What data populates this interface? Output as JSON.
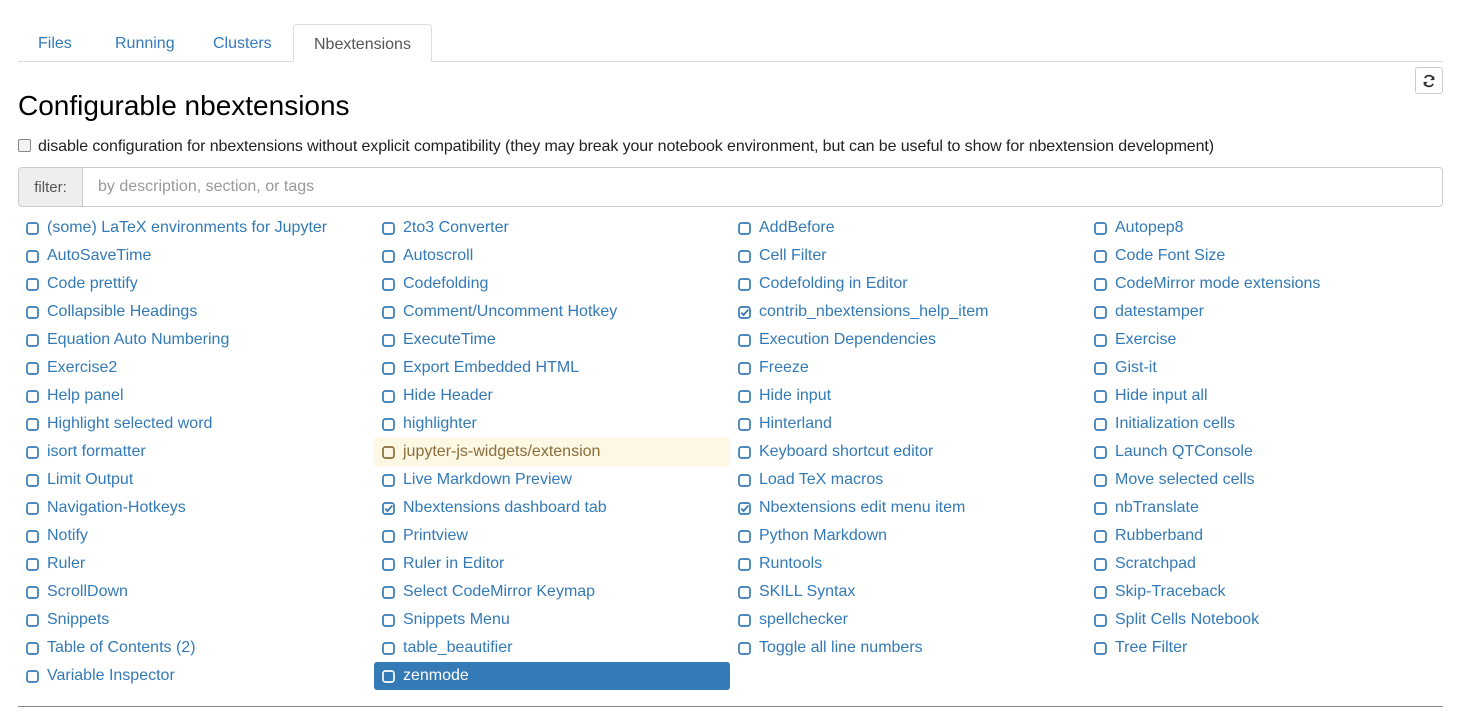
{
  "tabs": [
    {
      "label": "Files",
      "name": "files"
    },
    {
      "label": "Running",
      "name": "running"
    },
    {
      "label": "Clusters",
      "name": "clusters"
    },
    {
      "label": "Nbextensions",
      "name": "nbextensions",
      "active": true
    }
  ],
  "refresh": {
    "icon": "refresh-icon"
  },
  "title": "Configurable nbextensions",
  "compat": {
    "label": "disable configuration for nbextensions without explicit compatibility (they may break your notebook environment, but can be useful to show for nbextension development)",
    "checked": false
  },
  "filter": {
    "label": "filter:",
    "placeholder": "by description, section, or tags",
    "value": ""
  },
  "colors": {
    "link": "#337ab7",
    "warning_bg": "#fcf8e3",
    "warning_text": "#8a6d3b",
    "selected_bg": "#337ab7"
  },
  "extensions": [
    {
      "label": "(some) LaTeX environments for Jupyter",
      "checked": false
    },
    {
      "label": "2to3 Converter",
      "checked": false
    },
    {
      "label": "AddBefore",
      "checked": false
    },
    {
      "label": "Autopep8",
      "checked": false
    },
    {
      "label": "AutoSaveTime",
      "checked": false
    },
    {
      "label": "Autoscroll",
      "checked": false
    },
    {
      "label": "Cell Filter",
      "checked": false
    },
    {
      "label": "Code Font Size",
      "checked": false
    },
    {
      "label": "Code prettify",
      "checked": false
    },
    {
      "label": "Codefolding",
      "checked": false
    },
    {
      "label": "Codefolding in Editor",
      "checked": false
    },
    {
      "label": "CodeMirror mode extensions",
      "checked": false
    },
    {
      "label": "Collapsible Headings",
      "checked": false
    },
    {
      "label": "Comment/Uncomment Hotkey",
      "checked": false
    },
    {
      "label": "contrib_nbextensions_help_item",
      "checked": true
    },
    {
      "label": "datestamper",
      "checked": false
    },
    {
      "label": "Equation Auto Numbering",
      "checked": false
    },
    {
      "label": "ExecuteTime",
      "checked": false
    },
    {
      "label": "Execution Dependencies",
      "checked": false
    },
    {
      "label": "Exercise",
      "checked": false
    },
    {
      "label": "Exercise2",
      "checked": false
    },
    {
      "label": "Export Embedded HTML",
      "checked": false
    },
    {
      "label": "Freeze",
      "checked": false
    },
    {
      "label": "Gist-it",
      "checked": false
    },
    {
      "label": "Help panel",
      "checked": false
    },
    {
      "label": "Hide Header",
      "checked": false
    },
    {
      "label": "Hide input",
      "checked": false
    },
    {
      "label": "Hide input all",
      "checked": false
    },
    {
      "label": "Highlight selected word",
      "checked": false
    },
    {
      "label": "highlighter",
      "checked": false
    },
    {
      "label": "Hinterland",
      "checked": false
    },
    {
      "label": "Initialization cells",
      "checked": false
    },
    {
      "label": "isort formatter",
      "checked": false
    },
    {
      "label": "jupyter-js-widgets/extension",
      "checked": false,
      "state": "warning"
    },
    {
      "label": "Keyboard shortcut editor",
      "checked": false
    },
    {
      "label": "Launch QTConsole",
      "checked": false
    },
    {
      "label": "Limit Output",
      "checked": false
    },
    {
      "label": "Live Markdown Preview",
      "checked": false
    },
    {
      "label": "Load TeX macros",
      "checked": false
    },
    {
      "label": "Move selected cells",
      "checked": false
    },
    {
      "label": "Navigation-Hotkeys",
      "checked": false
    },
    {
      "label": "Nbextensions dashboard tab",
      "checked": true
    },
    {
      "label": "Nbextensions edit menu item",
      "checked": true
    },
    {
      "label": "nbTranslate",
      "checked": false
    },
    {
      "label": "Notify",
      "checked": false
    },
    {
      "label": "Printview",
      "checked": false
    },
    {
      "label": "Python Markdown",
      "checked": false
    },
    {
      "label": "Rubberband",
      "checked": false
    },
    {
      "label": "Ruler",
      "checked": false
    },
    {
      "label": "Ruler in Editor",
      "checked": false
    },
    {
      "label": "Runtools",
      "checked": false
    },
    {
      "label": "Scratchpad",
      "checked": false
    },
    {
      "label": "ScrollDown",
      "checked": false
    },
    {
      "label": "Select CodeMirror Keymap",
      "checked": false
    },
    {
      "label": "SKILL Syntax",
      "checked": false
    },
    {
      "label": "Skip-Traceback",
      "checked": false
    },
    {
      "label": "Snippets",
      "checked": false
    },
    {
      "label": "Snippets Menu",
      "checked": false
    },
    {
      "label": "spellchecker",
      "checked": false
    },
    {
      "label": "Split Cells Notebook",
      "checked": false
    },
    {
      "label": "Table of Contents (2)",
      "checked": false
    },
    {
      "label": "table_beautifier",
      "checked": false
    },
    {
      "label": "Toggle all line numbers",
      "checked": false
    },
    {
      "label": "Tree Filter",
      "checked": false
    },
    {
      "label": "Variable Inspector",
      "checked": false
    },
    {
      "label": "zenmode",
      "checked": false,
      "state": "selected"
    }
  ]
}
